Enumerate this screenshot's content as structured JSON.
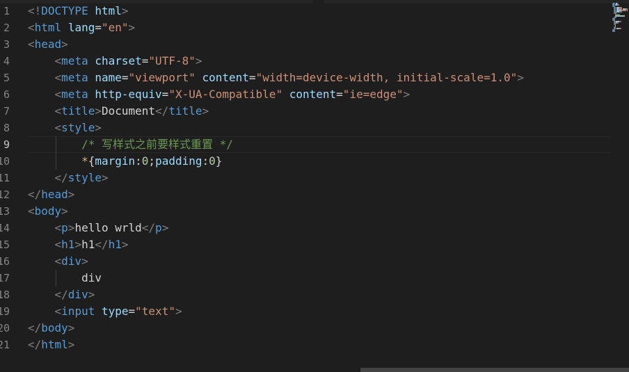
{
  "editor": {
    "active_line": 9,
    "line_numbers": [
      "1",
      "2",
      "3",
      "4",
      "5",
      "6",
      "7",
      "8",
      "9",
      "10",
      "11",
      "12",
      "13",
      "14",
      "15",
      "16",
      "17",
      "18",
      "19",
      "20",
      "21"
    ],
    "lines": [
      [
        {
          "t": "<!",
          "c": "br"
        },
        {
          "t": "DOCTYPE",
          "c": "tag"
        },
        {
          "t": " ",
          "c": "text"
        },
        {
          "t": "html",
          "c": "attr"
        },
        {
          "t": ">",
          "c": "br"
        }
      ],
      [
        {
          "t": "<",
          "c": "br"
        },
        {
          "t": "html",
          "c": "tag"
        },
        {
          "t": " ",
          "c": "text"
        },
        {
          "t": "lang",
          "c": "attr"
        },
        {
          "t": "=",
          "c": "eq"
        },
        {
          "t": "\"en\"",
          "c": "str"
        },
        {
          "t": ">",
          "c": "br"
        }
      ],
      [
        {
          "t": "<",
          "c": "br"
        },
        {
          "t": "head",
          "c": "tag"
        },
        {
          "t": ">",
          "c": "br"
        }
      ],
      [
        {
          "t": "    ",
          "c": "text"
        },
        {
          "t": "<",
          "c": "br"
        },
        {
          "t": "meta",
          "c": "tag"
        },
        {
          "t": " ",
          "c": "text"
        },
        {
          "t": "charset",
          "c": "attr"
        },
        {
          "t": "=",
          "c": "eq"
        },
        {
          "t": "\"UTF-8\"",
          "c": "str"
        },
        {
          "t": ">",
          "c": "br"
        }
      ],
      [
        {
          "t": "    ",
          "c": "text"
        },
        {
          "t": "<",
          "c": "br"
        },
        {
          "t": "meta",
          "c": "tag"
        },
        {
          "t": " ",
          "c": "text"
        },
        {
          "t": "name",
          "c": "attr"
        },
        {
          "t": "=",
          "c": "eq"
        },
        {
          "t": "\"viewport\"",
          "c": "str"
        },
        {
          "t": " ",
          "c": "text"
        },
        {
          "t": "content",
          "c": "attr"
        },
        {
          "t": "=",
          "c": "eq"
        },
        {
          "t": "\"width=device-width, initial-scale=1.0\"",
          "c": "str"
        },
        {
          "t": ">",
          "c": "br"
        }
      ],
      [
        {
          "t": "    ",
          "c": "text"
        },
        {
          "t": "<",
          "c": "br"
        },
        {
          "t": "meta",
          "c": "tag"
        },
        {
          "t": " ",
          "c": "text"
        },
        {
          "t": "http-equiv",
          "c": "attr"
        },
        {
          "t": "=",
          "c": "eq"
        },
        {
          "t": "\"X-UA-Compatible\"",
          "c": "str"
        },
        {
          "t": " ",
          "c": "text"
        },
        {
          "t": "content",
          "c": "attr"
        },
        {
          "t": "=",
          "c": "eq"
        },
        {
          "t": "\"ie=edge\"",
          "c": "str"
        },
        {
          "t": ">",
          "c": "br"
        }
      ],
      [
        {
          "t": "    ",
          "c": "text"
        },
        {
          "t": "<",
          "c": "br"
        },
        {
          "t": "title",
          "c": "tag"
        },
        {
          "t": ">",
          "c": "br"
        },
        {
          "t": "Document",
          "c": "text"
        },
        {
          "t": "</",
          "c": "br"
        },
        {
          "t": "title",
          "c": "tag"
        },
        {
          "t": ">",
          "c": "br"
        }
      ],
      [
        {
          "t": "    ",
          "c": "text"
        },
        {
          "t": "<",
          "c": "br"
        },
        {
          "t": "style",
          "c": "tag"
        },
        {
          "t": ">",
          "c": "br"
        }
      ],
      [
        {
          "t": "        ",
          "c": "text"
        },
        {
          "t": "/* 写样式之前要样式重置 */",
          "c": "cmt"
        }
      ],
      [
        {
          "t": "        ",
          "c": "text"
        },
        {
          "t": "*",
          "c": "sel"
        },
        {
          "t": "{",
          "c": "punc"
        },
        {
          "t": "margin",
          "c": "attr"
        },
        {
          "t": ":",
          "c": "punc"
        },
        {
          "t": "0",
          "c": "num"
        },
        {
          "t": ";",
          "c": "punc"
        },
        {
          "t": "padding",
          "c": "attr"
        },
        {
          "t": ":",
          "c": "punc"
        },
        {
          "t": "0",
          "c": "num"
        },
        {
          "t": "}",
          "c": "punc"
        }
      ],
      [
        {
          "t": "    ",
          "c": "text"
        },
        {
          "t": "</",
          "c": "br"
        },
        {
          "t": "style",
          "c": "tag"
        },
        {
          "t": ">",
          "c": "br"
        }
      ],
      [
        {
          "t": "</",
          "c": "br"
        },
        {
          "t": "head",
          "c": "tag"
        },
        {
          "t": ">",
          "c": "br"
        }
      ],
      [
        {
          "t": "<",
          "c": "br"
        },
        {
          "t": "body",
          "c": "tag"
        },
        {
          "t": ">",
          "c": "br"
        }
      ],
      [
        {
          "t": "    ",
          "c": "text"
        },
        {
          "t": "<",
          "c": "br"
        },
        {
          "t": "p",
          "c": "tag"
        },
        {
          "t": ">",
          "c": "br"
        },
        {
          "t": "hello wrld",
          "c": "text"
        },
        {
          "t": "</",
          "c": "br"
        },
        {
          "t": "p",
          "c": "tag"
        },
        {
          "t": ">",
          "c": "br"
        }
      ],
      [
        {
          "t": "    ",
          "c": "text"
        },
        {
          "t": "<",
          "c": "br"
        },
        {
          "t": "h1",
          "c": "tag"
        },
        {
          "t": ">",
          "c": "br"
        },
        {
          "t": "h1",
          "c": "text"
        },
        {
          "t": "</",
          "c": "br"
        },
        {
          "t": "h1",
          "c": "tag"
        },
        {
          "t": ">",
          "c": "br"
        }
      ],
      [
        {
          "t": "    ",
          "c": "text"
        },
        {
          "t": "<",
          "c": "br"
        },
        {
          "t": "div",
          "c": "tag"
        },
        {
          "t": ">",
          "c": "br"
        }
      ],
      [
        {
          "t": "        ",
          "c": "text"
        },
        {
          "t": "div",
          "c": "text"
        }
      ],
      [
        {
          "t": "    ",
          "c": "text"
        },
        {
          "t": "</",
          "c": "br"
        },
        {
          "t": "div",
          "c": "tag"
        },
        {
          "t": ">",
          "c": "br"
        }
      ],
      [
        {
          "t": "    ",
          "c": "text"
        },
        {
          "t": "<",
          "c": "br"
        },
        {
          "t": "input",
          "c": "tag"
        },
        {
          "t": " ",
          "c": "text"
        },
        {
          "t": "type",
          "c": "attr"
        },
        {
          "t": "=",
          "c": "eq"
        },
        {
          "t": "\"text\"",
          "c": "str"
        },
        {
          "t": ">",
          "c": "br"
        }
      ],
      [
        {
          "t": "</",
          "c": "br"
        },
        {
          "t": "body",
          "c": "tag"
        },
        {
          "t": ">",
          "c": "br"
        }
      ],
      [
        {
          "t": "</",
          "c": "br"
        },
        {
          "t": "html",
          "c": "tag"
        },
        {
          "t": ">",
          "c": "br"
        }
      ]
    ]
  },
  "theme": {
    "background": "#1e1e1e",
    "tag": "#569cd6",
    "attribute": "#9cdcfe",
    "string": "#ce9178",
    "comment": "#6a9955",
    "number": "#b5cea8",
    "line_number": "#858585"
  }
}
